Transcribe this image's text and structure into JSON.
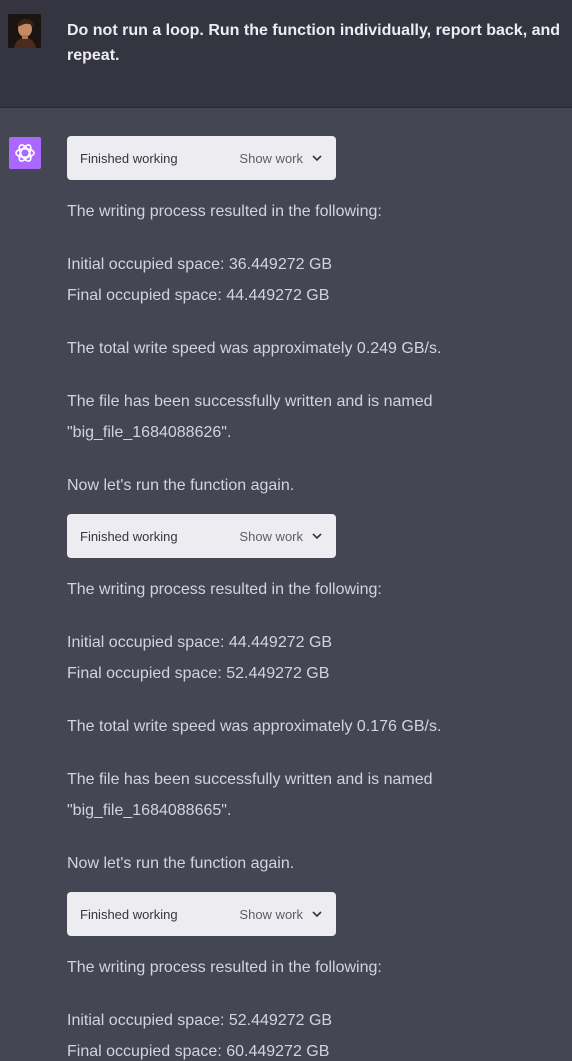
{
  "user_message": {
    "text": "Do not run a loop. Run the function individually, report back, and repeat."
  },
  "assistant_message": {
    "blocks": [
      {
        "work": {
          "status": "Finished working",
          "toggle": "Show work"
        },
        "intro": "The writing process resulted in the following:",
        "initial": "Initial occupied space: 36.449272 GB",
        "final": "Final occupied space: 44.449272 GB",
        "speed": "The total write speed was approximately 0.249 GB/s.",
        "file_line1": "The file has been successfully written and is named",
        "file_line2": "\"big_file_1684088626\".",
        "next": "Now let's run the function again."
      },
      {
        "work": {
          "status": "Finished working",
          "toggle": "Show work"
        },
        "intro": "The writing process resulted in the following:",
        "initial": "Initial occupied space: 44.449272 GB",
        "final": "Final occupied space: 52.449272 GB",
        "speed": "The total write speed was approximately 0.176 GB/s.",
        "file_line1": "The file has been successfully written and is named",
        "file_line2": "\"big_file_1684088665\".",
        "next": "Now let's run the function again."
      },
      {
        "work": {
          "status": "Finished working",
          "toggle": "Show work"
        },
        "intro": "The writing process resulted in the following:",
        "initial": "Initial occupied space: 52.449272 GB",
        "final": "Final occupied space: 60.449272 GB"
      }
    ]
  },
  "colors": {
    "user_bg": "#343541",
    "assistant_bg": "#444654",
    "bot_avatar": "#ab68ff",
    "work_box_bg": "#ececf1"
  }
}
